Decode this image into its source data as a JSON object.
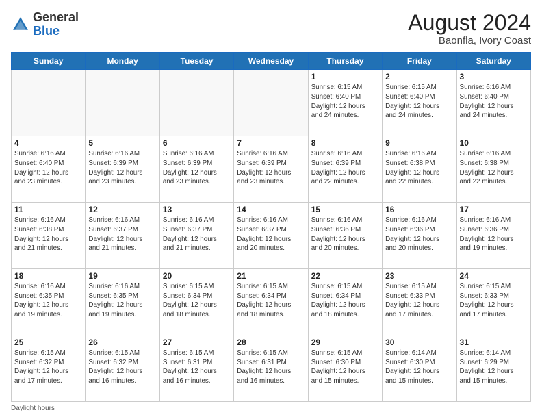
{
  "header": {
    "logo_general": "General",
    "logo_blue": "Blue",
    "month_year": "August 2024",
    "location": "Baonfla, Ivory Coast"
  },
  "days_of_week": [
    "Sunday",
    "Monday",
    "Tuesday",
    "Wednesday",
    "Thursday",
    "Friday",
    "Saturday"
  ],
  "weeks": [
    [
      {
        "day": "",
        "info": ""
      },
      {
        "day": "",
        "info": ""
      },
      {
        "day": "",
        "info": ""
      },
      {
        "day": "",
        "info": ""
      },
      {
        "day": "1",
        "info": "Sunrise: 6:15 AM\nSunset: 6:40 PM\nDaylight: 12 hours\nand 24 minutes."
      },
      {
        "day": "2",
        "info": "Sunrise: 6:15 AM\nSunset: 6:40 PM\nDaylight: 12 hours\nand 24 minutes."
      },
      {
        "day": "3",
        "info": "Sunrise: 6:16 AM\nSunset: 6:40 PM\nDaylight: 12 hours\nand 24 minutes."
      }
    ],
    [
      {
        "day": "4",
        "info": "Sunrise: 6:16 AM\nSunset: 6:40 PM\nDaylight: 12 hours\nand 23 minutes."
      },
      {
        "day": "5",
        "info": "Sunrise: 6:16 AM\nSunset: 6:39 PM\nDaylight: 12 hours\nand 23 minutes."
      },
      {
        "day": "6",
        "info": "Sunrise: 6:16 AM\nSunset: 6:39 PM\nDaylight: 12 hours\nand 23 minutes."
      },
      {
        "day": "7",
        "info": "Sunrise: 6:16 AM\nSunset: 6:39 PM\nDaylight: 12 hours\nand 23 minutes."
      },
      {
        "day": "8",
        "info": "Sunrise: 6:16 AM\nSunset: 6:39 PM\nDaylight: 12 hours\nand 22 minutes."
      },
      {
        "day": "9",
        "info": "Sunrise: 6:16 AM\nSunset: 6:38 PM\nDaylight: 12 hours\nand 22 minutes."
      },
      {
        "day": "10",
        "info": "Sunrise: 6:16 AM\nSunset: 6:38 PM\nDaylight: 12 hours\nand 22 minutes."
      }
    ],
    [
      {
        "day": "11",
        "info": "Sunrise: 6:16 AM\nSunset: 6:38 PM\nDaylight: 12 hours\nand 21 minutes."
      },
      {
        "day": "12",
        "info": "Sunrise: 6:16 AM\nSunset: 6:37 PM\nDaylight: 12 hours\nand 21 minutes."
      },
      {
        "day": "13",
        "info": "Sunrise: 6:16 AM\nSunset: 6:37 PM\nDaylight: 12 hours\nand 21 minutes."
      },
      {
        "day": "14",
        "info": "Sunrise: 6:16 AM\nSunset: 6:37 PM\nDaylight: 12 hours\nand 20 minutes."
      },
      {
        "day": "15",
        "info": "Sunrise: 6:16 AM\nSunset: 6:36 PM\nDaylight: 12 hours\nand 20 minutes."
      },
      {
        "day": "16",
        "info": "Sunrise: 6:16 AM\nSunset: 6:36 PM\nDaylight: 12 hours\nand 20 minutes."
      },
      {
        "day": "17",
        "info": "Sunrise: 6:16 AM\nSunset: 6:36 PM\nDaylight: 12 hours\nand 19 minutes."
      }
    ],
    [
      {
        "day": "18",
        "info": "Sunrise: 6:16 AM\nSunset: 6:35 PM\nDaylight: 12 hours\nand 19 minutes."
      },
      {
        "day": "19",
        "info": "Sunrise: 6:16 AM\nSunset: 6:35 PM\nDaylight: 12 hours\nand 19 minutes."
      },
      {
        "day": "20",
        "info": "Sunrise: 6:15 AM\nSunset: 6:34 PM\nDaylight: 12 hours\nand 18 minutes."
      },
      {
        "day": "21",
        "info": "Sunrise: 6:15 AM\nSunset: 6:34 PM\nDaylight: 12 hours\nand 18 minutes."
      },
      {
        "day": "22",
        "info": "Sunrise: 6:15 AM\nSunset: 6:34 PM\nDaylight: 12 hours\nand 18 minutes."
      },
      {
        "day": "23",
        "info": "Sunrise: 6:15 AM\nSunset: 6:33 PM\nDaylight: 12 hours\nand 17 minutes."
      },
      {
        "day": "24",
        "info": "Sunrise: 6:15 AM\nSunset: 6:33 PM\nDaylight: 12 hours\nand 17 minutes."
      }
    ],
    [
      {
        "day": "25",
        "info": "Sunrise: 6:15 AM\nSunset: 6:32 PM\nDaylight: 12 hours\nand 17 minutes."
      },
      {
        "day": "26",
        "info": "Sunrise: 6:15 AM\nSunset: 6:32 PM\nDaylight: 12 hours\nand 16 minutes."
      },
      {
        "day": "27",
        "info": "Sunrise: 6:15 AM\nSunset: 6:31 PM\nDaylight: 12 hours\nand 16 minutes."
      },
      {
        "day": "28",
        "info": "Sunrise: 6:15 AM\nSunset: 6:31 PM\nDaylight: 12 hours\nand 16 minutes."
      },
      {
        "day": "29",
        "info": "Sunrise: 6:15 AM\nSunset: 6:30 PM\nDaylight: 12 hours\nand 15 minutes."
      },
      {
        "day": "30",
        "info": "Sunrise: 6:14 AM\nSunset: 6:30 PM\nDaylight: 12 hours\nand 15 minutes."
      },
      {
        "day": "31",
        "info": "Sunrise: 6:14 AM\nSunset: 6:29 PM\nDaylight: 12 hours\nand 15 minutes."
      }
    ]
  ],
  "footer": {
    "note": "Daylight hours"
  }
}
